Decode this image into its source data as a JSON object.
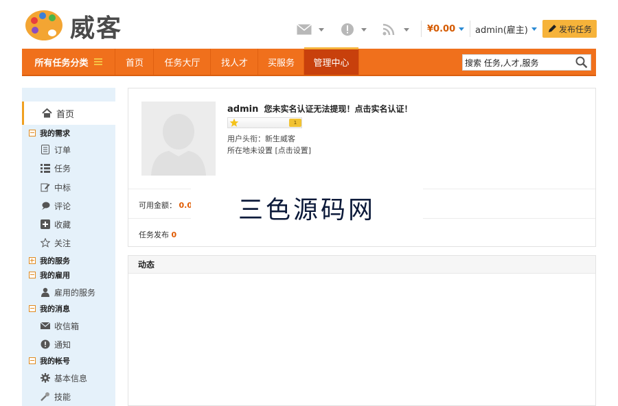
{
  "header": {
    "logo_text": "威客",
    "balance": "¥0.00",
    "user": "admin(雇主)",
    "publish_label": "发布任务"
  },
  "nav": {
    "all_categories": "所有任务分类",
    "items": [
      "首页",
      "任务大厅",
      "找人才",
      "买服务",
      "管理中心"
    ],
    "active": "管理中心"
  },
  "search": {
    "value": "搜索 任务,人才,服务"
  },
  "sidebar": {
    "home": "首页",
    "groups": [
      {
        "title": "我的需求",
        "expanded": true,
        "items": [
          "订单",
          "任务",
          "中标",
          "评论",
          "收藏",
          "关注"
        ]
      },
      {
        "title": "我的服务",
        "expanded": false,
        "items": []
      },
      {
        "title": "我的雇用",
        "expanded": true,
        "items": [
          "雇用的服务"
        ]
      },
      {
        "title": "我的消息",
        "expanded": true,
        "items": [
          "收信箱",
          "通知"
        ]
      },
      {
        "title": "我的帐号",
        "expanded": true,
        "items": [
          "基本信息",
          "技能"
        ]
      }
    ]
  },
  "profile": {
    "name": "admin",
    "notice": "您未实名认证无法提现！点击实名认证！",
    "level_badge": "1",
    "title_line": "用户头衔：新生威客",
    "location_line": "所在地未设置",
    "location_link": "[点击设置]"
  },
  "stats": {
    "balance_label": "可用金额：",
    "balance_value": "0.0",
    "tasks_label": "任务发布",
    "tasks_value": "0"
  },
  "watermark": "三色源码网",
  "activity": {
    "title": "动态"
  },
  "colors": {
    "nav": "#f0701c",
    "nav_active": "#c8400c",
    "accent": "#f6b33a",
    "sidebar": "#e5f1fa"
  }
}
